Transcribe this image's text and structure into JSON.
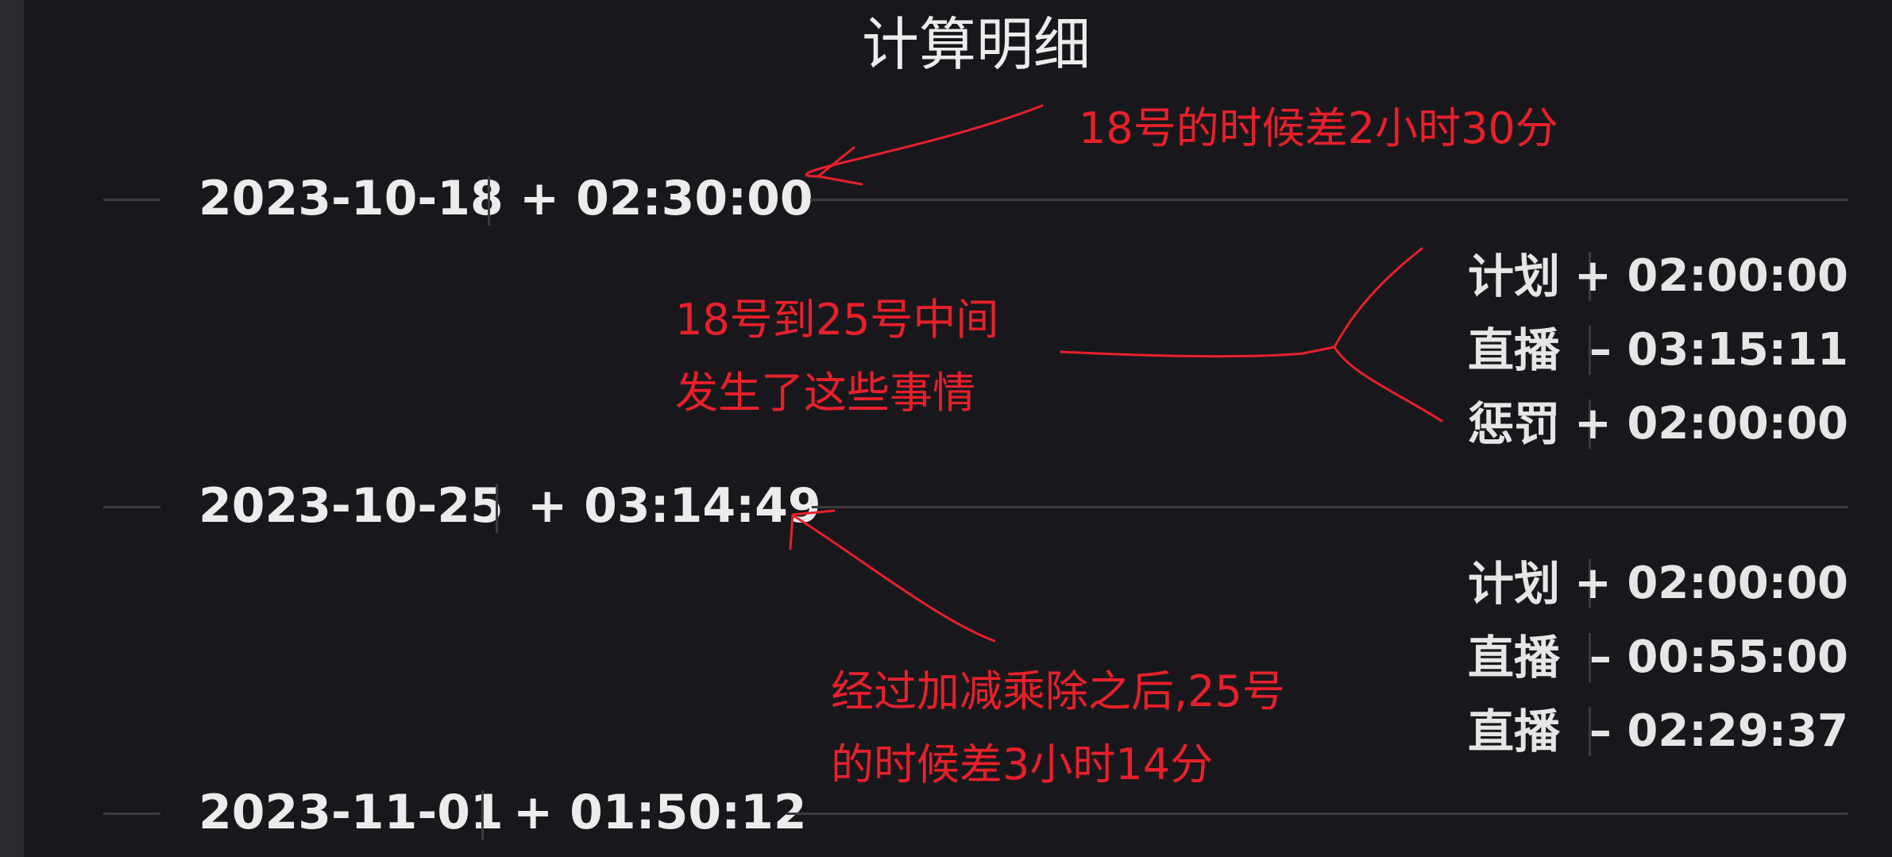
{
  "title": "计算明细",
  "entries": [
    {
      "date": "2023-10-18",
      "delta": "+ 02:30:00",
      "details": [
        {
          "label": "计划",
          "value": "+ 02:00:00"
        },
        {
          "label": "直播",
          "value": "– 03:15:11"
        },
        {
          "label": "惩罚",
          "value": "+ 02:00:00"
        }
      ]
    },
    {
      "date": "2023-10-25",
      "delta": "+ 03:14:49",
      "details": [
        {
          "label": "计划",
          "value": "+ 02:00:00"
        },
        {
          "label": "直播",
          "value": "– 00:55:00"
        },
        {
          "label": "直播",
          "value": "– 02:29:37"
        }
      ]
    },
    {
      "date": "2023-11-01",
      "delta": "+ 01:50:12"
    }
  ],
  "annotations": {
    "note1": "18号的时候差2小时30分",
    "note2": [
      "18号到25号中间",
      "发生了这些事情"
    ],
    "note3": [
      "经过加减乘除之后,25号",
      "的时候差3小时14分"
    ],
    "color": "#e8202a"
  },
  "colors": {
    "background": "#18181c",
    "text": "#ececec",
    "divider": "#3a3a40"
  }
}
